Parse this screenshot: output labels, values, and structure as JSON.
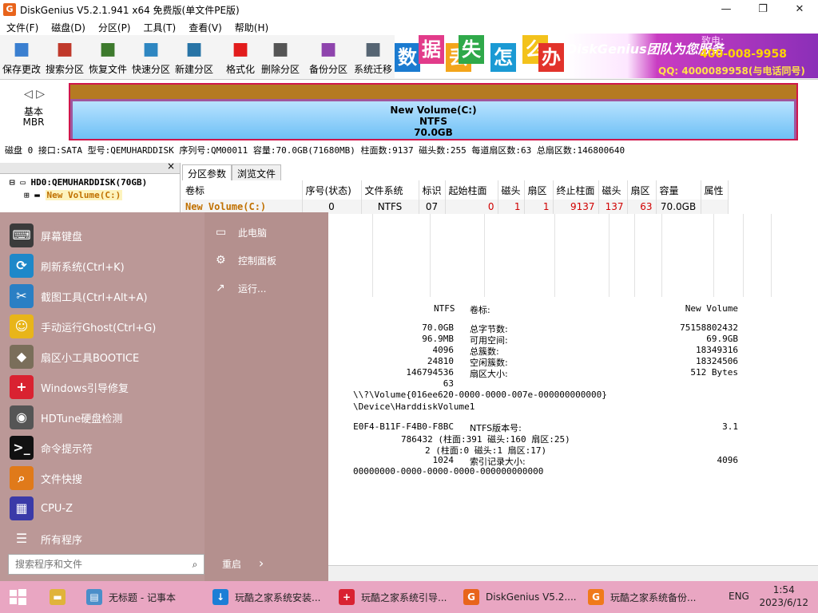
{
  "window": {
    "title": "DiskGenius V5.2.1.941 x64 免费版(单文件PE版)",
    "minimize": "—",
    "maximize": "❐",
    "close": "✕"
  },
  "menu": [
    "文件(F)",
    "磁盘(D)",
    "分区(P)",
    "工具(T)",
    "查看(V)",
    "帮助(H)"
  ],
  "toolbar": [
    {
      "label": "保存更改",
      "icon": "save-icon",
      "color": "#3a7fd0"
    },
    {
      "label": "搜索分区",
      "icon": "magnifier-icon",
      "color": "#c0392b"
    },
    {
      "label": "恢复文件",
      "icon": "recover-icon",
      "color": "#3d7a2d"
    },
    {
      "label": "快速分区",
      "icon": "quick-partition-icon",
      "color": "#2e86c1"
    },
    {
      "label": "新建分区",
      "icon": "new-partition-icon",
      "color": "#2874a6"
    },
    {
      "label": "格式化",
      "icon": "format-icon",
      "color": "#e21c1c"
    },
    {
      "label": "删除分区",
      "icon": "delete-partition-icon",
      "color": "#555555"
    },
    {
      "label": "备份分区",
      "icon": "backup-icon",
      "color": "#8e44ad"
    },
    {
      "label": "系统迁移",
      "icon": "migrate-icon",
      "color": "#566573"
    }
  ],
  "banner": {
    "chars": [
      {
        "c": "数",
        "bg": "#1b7bd0"
      },
      {
        "c": "据",
        "bg": "#e23b8a"
      },
      {
        "c": "丢",
        "bg": "#f3a51b"
      },
      {
        "c": "失",
        "bg": "#2fa94a"
      },
      {
        "c": "怎",
        "bg": "#1b9ad4"
      },
      {
        "c": "么",
        "bg": "#f3c21b"
      },
      {
        "c": "办",
        "bg": "#e2332b"
      }
    ],
    "brand": "DiskGenius团队为您服务",
    "phone_label": "致电:",
    "phone": "400-008-9958",
    "qq": "QQ: 4000089958(与电话同号)"
  },
  "diskmap": {
    "type_line1": "基本",
    "type_line2": "MBR",
    "nav": "◁ ▷",
    "volume": "New Volume(C:)",
    "fs": "NTFS",
    "size": "70.0GB"
  },
  "diskinfo": "磁盘 0 接口:SATA  型号:QEMUHARDDISK  序列号:QM00011  容量:70.0GB(71680MB)  柱面数:9137  磁头数:255  每道扇区数:63  总扇区数:146800640",
  "tree": {
    "disk": "HD0:QEMUHARDDISK(70GB)",
    "partition": "New Volume(C:)",
    "close": "×"
  },
  "tabs": [
    "分区参数",
    "浏览文件"
  ],
  "table": {
    "headers": [
      "卷标",
      "序号(状态)",
      "文件系统",
      "标识",
      "起始柱面",
      "磁头",
      "扇区",
      "终止柱面",
      "磁头",
      "扇区",
      "容量",
      "属性"
    ],
    "row": [
      "New Volume(C:)",
      "0",
      "NTFS",
      "07",
      "0",
      "1",
      "1",
      "9137",
      "137",
      "63",
      "70.0GB",
      ""
    ]
  },
  "details": {
    "fs_value": "NTFS",
    "label_key": "卷标:",
    "label_value": "New Volume",
    "col_values": [
      "70.0GB",
      "96.9MB",
      "4096",
      "24810",
      "146794536",
      "63"
    ],
    "col_keys": [
      "总字节数:",
      "可用空间:",
      "总簇数:",
      "空闲簇数:",
      "扇区大小:"
    ],
    "col_right": [
      "75158802432",
      "69.9GB",
      "18349316",
      "18324506",
      "512 Bytes"
    ],
    "guid_path": "\\\\?\\Volume{016ee620-0000-0000-007e-000000000000}",
    "device_path": "\\Device\\HarddiskVolume1",
    "serial": "E0F4-B11F-F4B0-F8BC",
    "ntfs_key": "NTFS版本号:",
    "ntfs_value": "3.1",
    "mft1": "786432 (柱面:391 磁头:160 扇区:25)",
    "mft2": "2 (柱面:0 磁头:1 扇区:17)",
    "index_val": "1024",
    "index_key": "索引记录大小:",
    "index_right": "4096",
    "guid2": "00000000-0000-0000-0000-000000000000"
  },
  "startmenu": {
    "items": [
      {
        "label": "屏幕键盘",
        "icon": "keyboard-icon",
        "color": "#3b3b3b",
        "glyph": "⌨"
      },
      {
        "label": "刷新系统(Ctrl+K)",
        "icon": "refresh-icon",
        "color": "#1e88c9",
        "glyph": "⟳"
      },
      {
        "label": "截图工具(Ctrl+Alt+A)",
        "icon": "screenshot-icon",
        "color": "#2a7fc4",
        "glyph": "✂"
      },
      {
        "label": "手动运行Ghost(Ctrl+G)",
        "icon": "ghost-icon",
        "color": "#e8b51a",
        "glyph": "☺"
      },
      {
        "label": "扇区小工具BOOTICE",
        "icon": "bootice-icon",
        "color": "#7a6e5a",
        "glyph": "◆"
      },
      {
        "label": "Windows引导修复",
        "icon": "boot-repair-icon",
        "color": "#d92231",
        "glyph": "+"
      },
      {
        "label": "HDTune硬盘检测",
        "icon": "hdtune-icon",
        "color": "#555555",
        "glyph": "◉"
      },
      {
        "label": "命令提示符",
        "icon": "cmd-icon",
        "color": "#111111",
        "glyph": ">_"
      },
      {
        "label": "文件快搜",
        "icon": "file-search-icon",
        "color": "#e07a1a",
        "glyph": "⌕"
      },
      {
        "label": "CPU-Z",
        "icon": "cpuz-icon",
        "color": "#3a3aa8",
        "glyph": "▦"
      },
      {
        "label": "所有程序",
        "icon": "all-programs-icon",
        "color": "transparent",
        "glyph": "☰"
      }
    ],
    "right": [
      {
        "label": "此电脑",
        "icon": "computer-icon",
        "glyph": "▭"
      },
      {
        "label": "控制面板",
        "icon": "control-panel-icon",
        "glyph": "⚙"
      },
      {
        "label": "运行...",
        "icon": "run-icon",
        "glyph": "↗"
      }
    ],
    "search_placeholder": "搜索程序和文件",
    "restart": "重启",
    "restart_arrow": "›"
  },
  "taskbar": {
    "items": [
      {
        "label": "",
        "icon": "folder-icon",
        "color": "#e0b33a",
        "glyph": "▬"
      },
      {
        "label": "无标题 - 记事本",
        "icon": "notepad-icon",
        "color": "#4a8ec9",
        "glyph": "▤"
      },
      {
        "label": "玩酷之家系统安装...",
        "icon": "install-icon",
        "color": "#1c7ed6",
        "glyph": "↓"
      },
      {
        "label": "玩酷之家系统引导...",
        "icon": "boot-icon",
        "color": "#d92231",
        "glyph": "+"
      },
      {
        "label": "DiskGenius V5.2....",
        "icon": "diskgenius-icon",
        "color": "#e8641b",
        "glyph": "G"
      },
      {
        "label": "玩酷之家系统备份...",
        "icon": "backup-app-icon",
        "color": "#f07a1a",
        "glyph": "G"
      }
    ],
    "lang": "ENG",
    "time": "1:54",
    "date": "2023/6/12"
  }
}
